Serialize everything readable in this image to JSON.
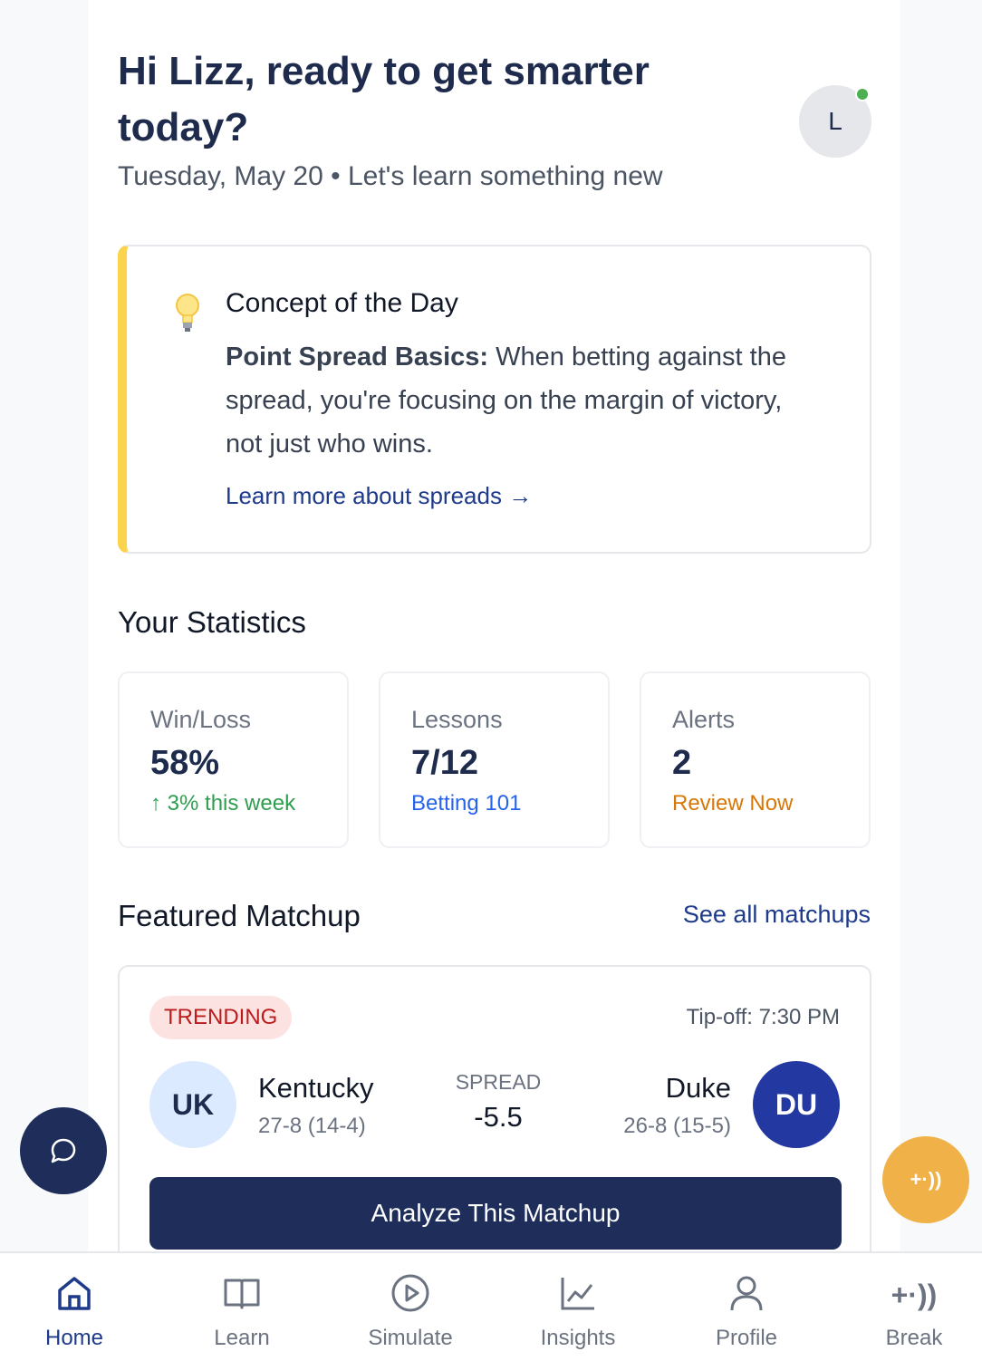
{
  "header": {
    "greeting": "Hi Lizz, ready to get smarter today?",
    "date_line": "Tuesday, May 20 • Let's learn something new",
    "avatar_initial": "L"
  },
  "concept": {
    "title": "Concept of the Day",
    "lead": "Point Spread Basics:",
    "body": " When betting against the spread, you're focusing on the margin of victory, not just who wins.",
    "link": "Learn more about spreads →"
  },
  "stats": {
    "title": "Your Statistics",
    "cards": [
      {
        "label": "Win/Loss",
        "value": "58%",
        "sub": "↑ 3% this week",
        "sub_color": "#2e9e4f"
      },
      {
        "label": "Lessons",
        "value": "7/12",
        "sub": "Betting 101",
        "sub_color": "#2563eb"
      },
      {
        "label": "Alerts",
        "value": "2",
        "sub": "Review Now",
        "sub_color": "#d97706"
      }
    ]
  },
  "featured": {
    "title": "Featured Matchup",
    "see_all": "See all matchups",
    "badge": "TRENDING",
    "tipoff": "Tip-off: 7:30 PM",
    "home": {
      "abbr": "UK",
      "name": "Kentucky",
      "record": "27-8 (14-4)"
    },
    "away": {
      "abbr": "DU",
      "name": "Duke",
      "record": "26-8 (15-5)"
    },
    "spread_label": "SPREAD",
    "spread_value": "-5.5",
    "button": "Analyze This Matchup"
  },
  "fab": {
    "break_label": "+·))"
  },
  "tabs": [
    {
      "label": "Home",
      "icon": "home-icon",
      "active": true
    },
    {
      "label": "Learn",
      "icon": "book-icon",
      "active": false
    },
    {
      "label": "Simulate",
      "icon": "play-icon",
      "active": false
    },
    {
      "label": "Insights",
      "icon": "chart-icon",
      "active": false
    },
    {
      "label": "Profile",
      "icon": "user-icon",
      "active": false
    },
    {
      "label": "Break",
      "icon": "break-icon",
      "active": false
    }
  ]
}
